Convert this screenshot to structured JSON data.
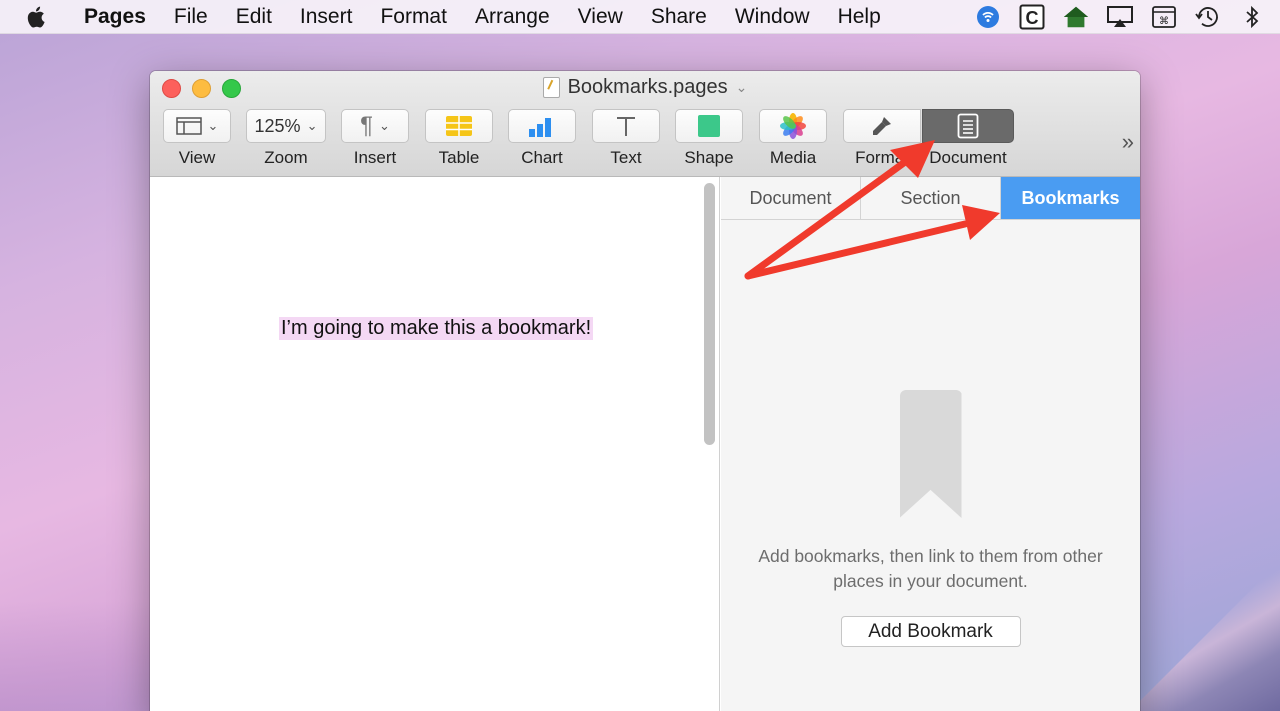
{
  "menubar": {
    "app_name": "Pages",
    "items": [
      "File",
      "Edit",
      "Insert",
      "Format",
      "Arrange",
      "View",
      "Share",
      "Window",
      "Help"
    ],
    "status_icons": [
      "wifi-icon",
      "clipboard-c-icon",
      "house-icon",
      "airplay-icon",
      "keyboard-shortcut-icon",
      "time-machine-icon",
      "bluetooth-icon"
    ]
  },
  "window": {
    "title": "Bookmarks.pages",
    "toolbar": {
      "view_label": "View",
      "zoom_value": "125%",
      "zoom_label": "Zoom",
      "insert_label": "Insert",
      "table_label": "Table",
      "chart_label": "Chart",
      "text_label": "Text",
      "shape_label": "Shape",
      "media_label": "Media",
      "format_label": "Format",
      "document_label": "Document",
      "overflow": "»"
    },
    "document": {
      "text": "I’m going to make this a bookmark!"
    },
    "inspector": {
      "tabs": [
        "Document",
        "Section",
        "Bookmarks"
      ],
      "selected_tab": "Bookmarks",
      "empty_message": "Add bookmarks, then link to them from other places in your document.",
      "add_button": "Add Bookmark"
    }
  },
  "colors": {
    "accent_tab": "#4a9cf2",
    "annotation_arrow": "#f03a2c",
    "highlight": "#f4d8f4"
  }
}
